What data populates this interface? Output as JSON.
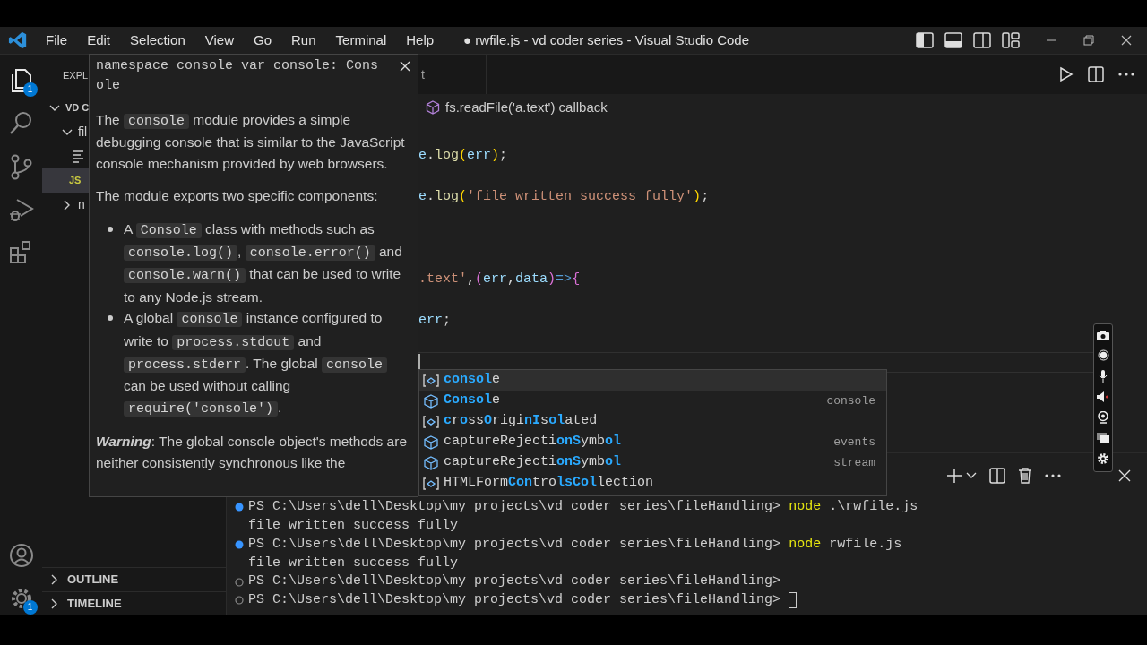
{
  "title_bar": {
    "menu": [
      "File",
      "Edit",
      "Selection",
      "View",
      "Go",
      "Run",
      "Terminal",
      "Help"
    ],
    "title": "● rwfile.js - vd coder series - Visual Studio Code"
  },
  "activity_bar": {
    "items": [
      {
        "kind": "explorer",
        "selected": true,
        "badge": "1"
      },
      {
        "kind": "search",
        "selected": false
      },
      {
        "kind": "source-control",
        "selected": false
      },
      {
        "kind": "run-debug",
        "selected": false
      },
      {
        "kind": "extensions",
        "selected": false
      }
    ],
    "bottom": [
      {
        "kind": "account"
      },
      {
        "kind": "settings",
        "badge": "1"
      }
    ]
  },
  "sidebar": {
    "header": "EXPL",
    "tree": [
      {
        "kind": "root",
        "label": "VD C",
        "expanded": true,
        "selected": false,
        "children": [
          {
            "kind": "folder",
            "label": "fil",
            "expanded": true,
            "selected": false,
            "children": [
              {
                "kind": "text-file",
                "selected": false
              },
              {
                "kind": "js-file",
                "icon_text": "JS",
                "selected": true
              }
            ]
          },
          {
            "kind": "folder",
            "label": "n",
            "expanded": false,
            "selected": false
          }
        ]
      }
    ],
    "sections": [
      {
        "label": "OUTLINE",
        "expanded": false
      },
      {
        "label": "TIMELINE",
        "expanded": false
      }
    ]
  },
  "editor": {
    "tab": {
      "label": "t"
    },
    "breadcrumb": "fs.readFile('a.text') callback",
    "lines": [
      {
        "kind": "blank"
      },
      {
        "kind": "code",
        "tokens": [
          {
            "kind": "var",
            "text": "e"
          },
          {
            "kind": "punct",
            "text": "."
          },
          {
            "kind": "fn",
            "text": "log"
          },
          {
            "kind": "bracket1",
            "text": "("
          },
          {
            "kind": "var",
            "text": "err"
          },
          {
            "kind": "bracket1",
            "text": ")"
          },
          {
            "kind": "punct",
            "text": ";"
          }
        ]
      },
      {
        "kind": "blank"
      },
      {
        "kind": "code",
        "tokens": [
          {
            "kind": "var",
            "text": "e"
          },
          {
            "kind": "punct",
            "text": "."
          },
          {
            "kind": "fn",
            "text": "log"
          },
          {
            "kind": "bracket1",
            "text": "("
          },
          {
            "kind": "str",
            "text": "'file written success fully'"
          },
          {
            "kind": "bracket1",
            "text": ")"
          },
          {
            "kind": "punct",
            "text": ";"
          }
        ]
      },
      {
        "kind": "blank"
      },
      {
        "kind": "blank"
      },
      {
        "kind": "blank"
      },
      {
        "kind": "code",
        "tokens": [
          {
            "kind": "str",
            "text": ".text'"
          },
          {
            "kind": "punct",
            "text": ","
          },
          {
            "kind": "bracket2",
            "text": "("
          },
          {
            "kind": "var",
            "text": "err"
          },
          {
            "kind": "punct",
            "text": ","
          },
          {
            "kind": "var",
            "text": "data"
          },
          {
            "kind": "bracket2",
            "text": ")"
          },
          {
            "kind": "op",
            "text": "=>"
          },
          {
            "kind": "bracket2",
            "text": "{"
          }
        ]
      },
      {
        "kind": "blank"
      },
      {
        "kind": "code",
        "tokens": [
          {
            "kind": "var",
            "text": "err"
          },
          {
            "kind": "punct",
            "text": ";"
          }
        ]
      },
      {
        "kind": "blank"
      },
      {
        "kind": "current"
      }
    ]
  },
  "hover": {
    "signature_lines": [
      "namespace console var console: Cons",
      "ole"
    ],
    "blocks": [
      {
        "kind": "paragraph",
        "segments": [
          {
            "kind": "text",
            "text": "The "
          },
          {
            "kind": "code",
            "text": "console"
          },
          {
            "kind": "text",
            "text": " module provides a simple debugging console that is similar to the JavaScript console mechanism provided by web browsers."
          }
        ]
      },
      {
        "kind": "paragraph",
        "segments": [
          {
            "kind": "text",
            "text": "The module exports two specific components:"
          }
        ]
      },
      {
        "kind": "list",
        "items": [
          {
            "segments": [
              {
                "kind": "text",
                "text": "A "
              },
              {
                "kind": "code",
                "text": "Console"
              },
              {
                "kind": "text",
                "text": " class with methods such as "
              },
              {
                "kind": "code",
                "text": "console.log()"
              },
              {
                "kind": "text",
                "text": ", "
              },
              {
                "kind": "code",
                "text": "console.error()"
              },
              {
                "kind": "text",
                "text": " and "
              },
              {
                "kind": "code",
                "text": "console.warn()"
              },
              {
                "kind": "text",
                "text": " that can be used to write to any Node.js stream."
              }
            ]
          },
          {
            "segments": [
              {
                "kind": "text",
                "text": "A global "
              },
              {
                "kind": "code",
                "text": "console"
              },
              {
                "kind": "text",
                "text": " instance configured to write to "
              },
              {
                "kind": "code",
                "text": "process.stdout"
              },
              {
                "kind": "text",
                "text": " and "
              },
              {
                "kind": "code",
                "text": "process.stderr"
              },
              {
                "kind": "text",
                "text": ". The global "
              },
              {
                "kind": "code",
                "text": "console"
              },
              {
                "kind": "text",
                "text": " can be used without calling "
              },
              {
                "kind": "code",
                "text": "require('console')"
              },
              {
                "kind": "text",
                "text": "."
              }
            ]
          }
        ]
      },
      {
        "kind": "paragraph",
        "segments": [
          {
            "kind": "strong",
            "text": "Warning"
          },
          {
            "kind": "text",
            "text": ": The global console object's methods are neither consistently synchronous like the"
          }
        ]
      }
    ]
  },
  "suggestions": [
    {
      "kind": "variable",
      "selected": true,
      "segments": [
        {
          "text": "consol",
          "match": true
        },
        {
          "text": "e",
          "match": false
        }
      ]
    },
    {
      "kind": "class",
      "selected": false,
      "detail": "console",
      "segments": [
        {
          "text": "Consol",
          "match": true
        },
        {
          "text": "e",
          "match": false
        }
      ]
    },
    {
      "kind": "variable",
      "selected": false,
      "segments": [
        {
          "text": "c",
          "match": true
        },
        {
          "text": "r",
          "match": false
        },
        {
          "text": "o",
          "match": true
        },
        {
          "text": "ss",
          "match": false
        },
        {
          "text": "O",
          "match": true
        },
        {
          "text": "rigi",
          "match": false
        },
        {
          "text": "nI",
          "match": true
        },
        {
          "text": "s",
          "match": false
        },
        {
          "text": "ol",
          "match": true
        },
        {
          "text": "ated",
          "match": false
        }
      ]
    },
    {
      "kind": "class",
      "selected": false,
      "detail": "events",
      "segments": [
        {
          "text": "captureRejecti",
          "match": false
        },
        {
          "text": "onS",
          "match": true
        },
        {
          "text": "ymb",
          "match": false
        },
        {
          "text": "ol",
          "match": true
        }
      ]
    },
    {
      "kind": "class",
      "selected": false,
      "detail": "stream",
      "segments": [
        {
          "text": "captureRejecti",
          "match": false
        },
        {
          "text": "onS",
          "match": true
        },
        {
          "text": "ymb",
          "match": false
        },
        {
          "text": "ol",
          "match": true
        }
      ]
    },
    {
      "kind": "variable",
      "selected": false,
      "segments": [
        {
          "text": "HTMLForm",
          "match": false
        },
        {
          "text": "Con",
          "match": true
        },
        {
          "text": "tro",
          "match": false
        },
        {
          "text": "lsCol",
          "match": true
        },
        {
          "text": "lection",
          "match": false
        }
      ]
    }
  ],
  "terminal": {
    "lines": [
      {
        "kind": "prompt",
        "success": true,
        "prompt": "PS C:\\Users\\dell\\Desktop\\my projects\\vd coder series\\fileHandling>",
        "command": "node",
        "args": ".\\rwfile.js",
        "cursor": false
      },
      {
        "kind": "output",
        "text": "file written success fully"
      },
      {
        "kind": "prompt",
        "success": true,
        "prompt": "PS C:\\Users\\dell\\Desktop\\my projects\\vd coder series\\fileHandling>",
        "command": "node",
        "args": "rwfile.js",
        "cursor": false
      },
      {
        "kind": "output",
        "text": "file written success fully"
      },
      {
        "kind": "prompt",
        "success": false,
        "prompt": "PS C:\\Users\\dell\\Desktop\\my projects\\vd coder series\\fileHandling>",
        "cursor": false
      },
      {
        "kind": "prompt",
        "success": false,
        "prompt": "PS C:\\Users\\dell\\Desktop\\my projects\\vd coder series\\fileHandling>",
        "cursor": true
      }
    ]
  }
}
